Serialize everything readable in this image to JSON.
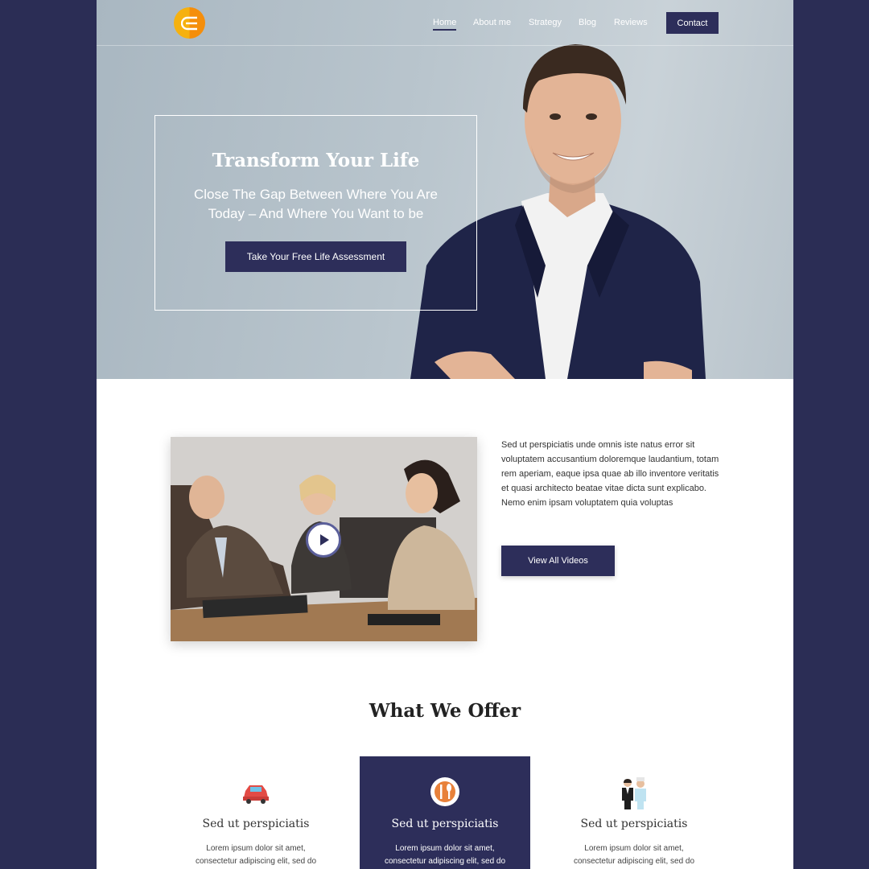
{
  "nav": {
    "items": [
      {
        "label": "Home",
        "active": true
      },
      {
        "label": "About me"
      },
      {
        "label": "Strategy"
      },
      {
        "label": "Blog"
      },
      {
        "label": "Reviews"
      }
    ],
    "contact_label": "Contact"
  },
  "hero": {
    "title": "Transform Your Life",
    "subtitle_line1": "Close The Gap Between Where You Are",
    "subtitle_line2": "Today – And Where You Want to be",
    "cta_label": "Take Your Free Life Assessment"
  },
  "video_section": {
    "text": "Sed ut perspiciatis unde omnis iste natus error sit voluptatem accusantium doloremque laudantium, totam rem aperiam, eaque ipsa quae ab illo inventore veritatis et quasi architecto beatae vitae dicta sunt explicabo. Nemo enim ipsam voluptatem quia voluptas",
    "button_label": "View All Videos"
  },
  "offer": {
    "title": "What We Offer",
    "cards": [
      {
        "icon": "car-icon",
        "title": "Sed ut perspiciatis",
        "text_line1": "Lorem ipsum dolor sit amet,",
        "text_line2": "consectetur adipiscing elit, sed do"
      },
      {
        "icon": "cutlery-icon",
        "title": "Sed ut perspiciatis",
        "text_line1": "Lorem ipsum dolor sit amet,",
        "text_line2": "consectetur adipiscing elit, sed do"
      },
      {
        "icon": "staff-icon",
        "title": "Sed ut perspiciatis",
        "text_line1": "Lorem ipsum dolor sit amet,",
        "text_line2": "consectetur adipiscing elit, sed do"
      }
    ]
  },
  "colors": {
    "background": "#2b2d55",
    "accent": "#2d2e5a",
    "logo_orange": "#f6b10f"
  }
}
